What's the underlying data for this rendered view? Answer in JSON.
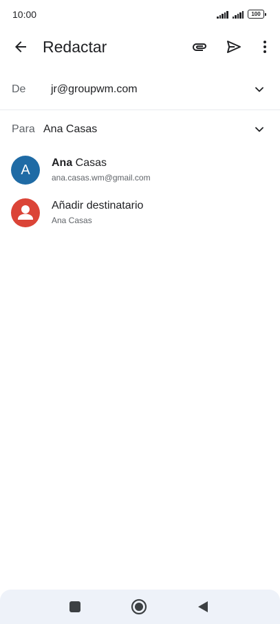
{
  "status_bar": {
    "time": "10:00",
    "battery": "100"
  },
  "app_bar": {
    "title": "Redactar"
  },
  "from": {
    "label": "De",
    "value": "jr@groupwm.com"
  },
  "to": {
    "label": "Para",
    "value": "Ana Casas"
  },
  "suggestions": [
    {
      "avatar_letter": "A",
      "name_bold": "Ana",
      "name_rest": " Casas",
      "email": "ana.casas.wm@gmail.com",
      "avatar_color": "#1f6ba5"
    },
    {
      "title": "Añadir destinatario",
      "subtitle": "Ana Casas",
      "avatar_color": "#db4437"
    }
  ],
  "icons": {
    "back": "arrow-left-icon",
    "attach": "paperclip-icon",
    "send": "send-icon",
    "more": "more-vert-icon",
    "chevron": "chevron-down-icon",
    "person": "person-icon",
    "nav_recent": "square-icon",
    "nav_home": "circle-icon",
    "nav_back": "triangle-icon"
  }
}
